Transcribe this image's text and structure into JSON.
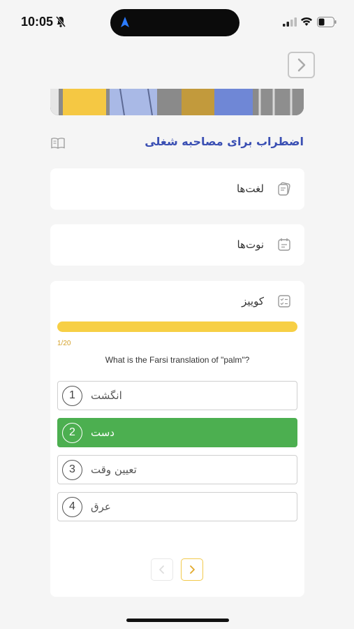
{
  "status": {
    "time": "10:05"
  },
  "lesson": {
    "title": "اضطراب برای مصاحبه شغلی"
  },
  "sections": {
    "vocab": {
      "label": "لغت‌ها"
    },
    "notes": {
      "label": "نوت‌ها"
    },
    "quiz": {
      "label": "کوییز"
    }
  },
  "quiz": {
    "counter": "1/20",
    "progress": 1.0,
    "question": "What is the Farsi translation of \"palm\"?",
    "options": [
      {
        "num": "1",
        "text": "انگشت",
        "selected": false
      },
      {
        "num": "2",
        "text": "دست",
        "selected": true
      },
      {
        "num": "3",
        "text": "تعیین وقت",
        "selected": false
      },
      {
        "num": "4",
        "text": "عرق",
        "selected": false
      }
    ]
  },
  "colors": {
    "accent": "#3a4fb3",
    "progress": "#f7cf45",
    "selected": "#4caf50",
    "background": "#f5f5f5"
  },
  "icons": {
    "top_nav": "chevron-right-icon",
    "lesson": "book-icon",
    "vocab": "vocab-card-icon",
    "notes": "notes-icon",
    "quiz": "quiz-checklist-icon",
    "prev": "chevron-left-icon",
    "next": "chevron-right-icon"
  }
}
